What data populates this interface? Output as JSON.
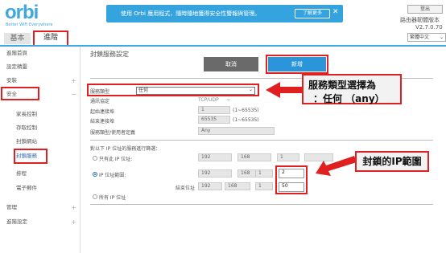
{
  "header": {
    "logo": "orbi",
    "tagline": "Better WiFi Everywhere",
    "banner_text": "使用 Orbi 應用程式，隨時隨地獲得安全性警報與管理。",
    "banner_button": "了解更多",
    "banner_close": "✕",
    "logout": "登出",
    "model": "路由器韌體版本",
    "version": "V2.7.0.70",
    "language": "繁體中文"
  },
  "tabs": {
    "basic": "基本",
    "advanced": "進階"
  },
  "sidebar": {
    "items": [
      {
        "label": "進階首頁"
      },
      {
        "label": "設定精靈"
      },
      {
        "label": "安裝",
        "toggle": "+"
      },
      {
        "label": "安全",
        "toggle": "−"
      },
      {
        "label": "家長控制"
      },
      {
        "label": "存取控制"
      },
      {
        "label": "封鎖網站"
      },
      {
        "label": "封鎖服務"
      },
      {
        "label": "排程"
      },
      {
        "label": "電子郵件"
      },
      {
        "label": "管理",
        "toggle": "+"
      },
      {
        "label": "進階設定",
        "toggle": "+"
      }
    ]
  },
  "main": {
    "title": "封鎖服務設定",
    "cancel": "取消",
    "apply": "新增",
    "service_type_label": "服務類型",
    "service_type_value": "任何",
    "protocol_label": "通訊協定",
    "protocol_value": "TCP/UDP",
    "start_port_label": "起始連接埠",
    "start_port_value": "1",
    "start_port_range": "(1~65535)",
    "end_port_label": "結束連接埠",
    "end_port_value": "65535",
    "end_port_range": "(1~65535)",
    "user_defined_label": "服務類型/使用者定義",
    "user_defined_value": "Any",
    "filter_heading": "對以下 IP 位址的服務進行篩選：",
    "opt_single": "只有此 IP 位址:",
    "opt_range": "IP 位址範圍:",
    "end_addr_label": "結束位址",
    "opt_all": "所有 IP 位址",
    "single_ip": [
      "192",
      "168",
      "1",
      ""
    ],
    "range_start": [
      "192",
      "168",
      "1",
      "2"
    ],
    "range_end": [
      "192",
      "168",
      "1",
      "50"
    ]
  },
  "callouts": {
    "service_line1": "服務類型選擇為",
    "service_line2": "：任何 （any）",
    "ip_range": "封鎖的IP範圍"
  },
  "colors": {
    "accent": "#3fa8e0",
    "annotation": "#e02020",
    "apply": "#2a95d8"
  }
}
